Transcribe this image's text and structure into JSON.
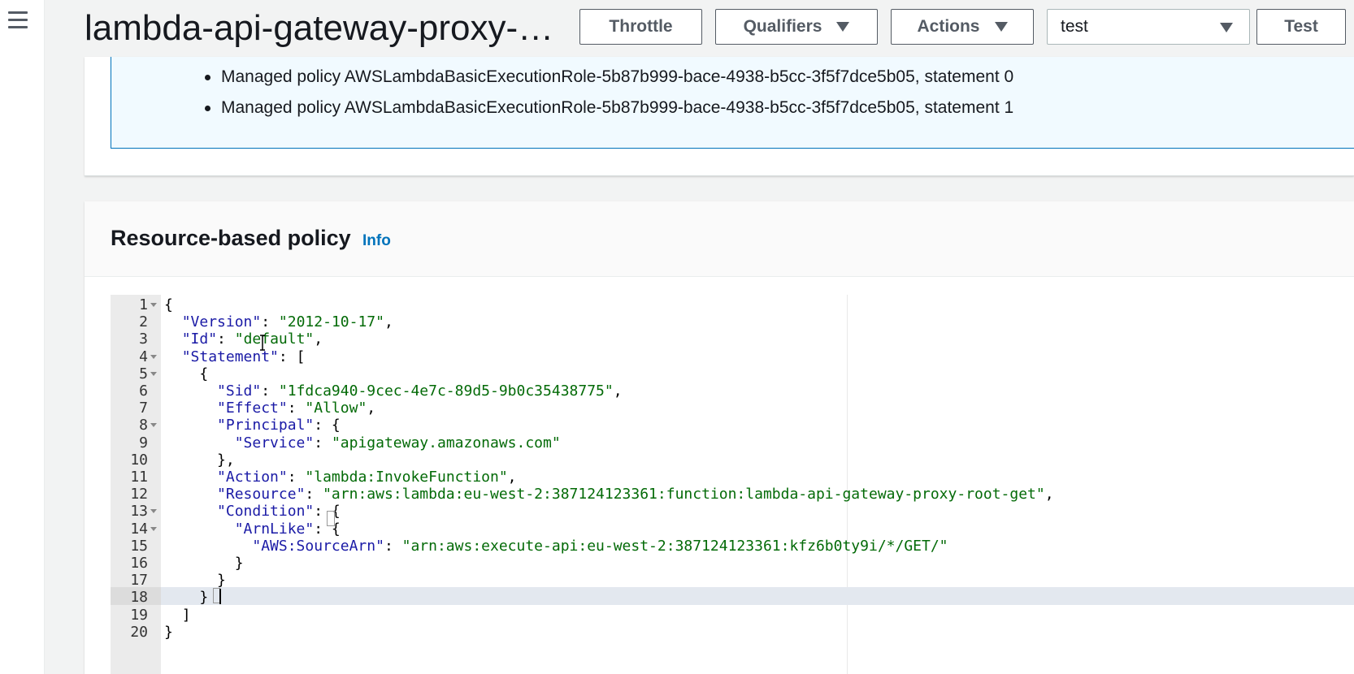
{
  "header": {
    "title": "lambda-api-gateway-proxy-…",
    "buttons": {
      "throttle": "Throttle",
      "qualifiers": "Qualifiers",
      "actions": "Actions",
      "test": "Test"
    },
    "test_event_select": "test"
  },
  "permissions_box": {
    "items": [
      "Managed policy AWSLambdaBasicExecutionRole-5b87b999-bace-4938-b5cc-3f5f7dce5b05, statement 0",
      "Managed policy AWSLambdaBasicExecutionRole-5b87b999-bace-4938-b5cc-3f5f7dce5b05, statement 1"
    ]
  },
  "resource_policy": {
    "title": "Resource-based policy",
    "info_link": "Info",
    "lines": [
      {
        "n": "1",
        "fold": true,
        "indent": "",
        "html": [
          [
            "p",
            "{"
          ]
        ]
      },
      {
        "n": "2",
        "fold": false,
        "indent": "  ",
        "html": [
          [
            "k",
            "\"Version\""
          ],
          [
            "p",
            ": "
          ],
          [
            "s",
            "\"2012-10-17\""
          ],
          [
            "p",
            ","
          ]
        ]
      },
      {
        "n": "3",
        "fold": false,
        "indent": "  ",
        "html": [
          [
            "k",
            "\"Id\""
          ],
          [
            "p",
            ": "
          ],
          [
            "s",
            "\"default\""
          ],
          [
            "p",
            ","
          ]
        ]
      },
      {
        "n": "4",
        "fold": true,
        "indent": "  ",
        "html": [
          [
            "k",
            "\"Statement\""
          ],
          [
            "p",
            ": ["
          ]
        ]
      },
      {
        "n": "5",
        "fold": true,
        "indent": "    ",
        "html": [
          [
            "p",
            "{"
          ]
        ]
      },
      {
        "n": "6",
        "fold": false,
        "indent": "      ",
        "html": [
          [
            "k",
            "\"Sid\""
          ],
          [
            "p",
            ": "
          ],
          [
            "s",
            "\"1fdca940-9cec-4e7c-89d5-9b0c35438775\""
          ],
          [
            "p",
            ","
          ]
        ]
      },
      {
        "n": "7",
        "fold": false,
        "indent": "      ",
        "html": [
          [
            "k",
            "\"Effect\""
          ],
          [
            "p",
            ": "
          ],
          [
            "s",
            "\"Allow\""
          ],
          [
            "p",
            ","
          ]
        ]
      },
      {
        "n": "8",
        "fold": true,
        "indent": "      ",
        "html": [
          [
            "k",
            "\"Principal\""
          ],
          [
            "p",
            ": {"
          ]
        ]
      },
      {
        "n": "9",
        "fold": false,
        "indent": "        ",
        "html": [
          [
            "k",
            "\"Service\""
          ],
          [
            "p",
            ": "
          ],
          [
            "s",
            "\"apigateway.amazonaws.com\""
          ]
        ]
      },
      {
        "n": "10",
        "fold": false,
        "indent": "      ",
        "html": [
          [
            "p",
            "},"
          ]
        ]
      },
      {
        "n": "11",
        "fold": false,
        "indent": "      ",
        "html": [
          [
            "k",
            "\"Action\""
          ],
          [
            "p",
            ": "
          ],
          [
            "s",
            "\"lambda:InvokeFunction\""
          ],
          [
            "p",
            ","
          ]
        ]
      },
      {
        "n": "12",
        "fold": false,
        "indent": "      ",
        "html": [
          [
            "k",
            "\"Resource\""
          ],
          [
            "p",
            ": "
          ],
          [
            "s",
            "\"arn:aws:lambda:eu-west-2:387124123361:function:lambda-api-gateway-proxy-root-get\""
          ],
          [
            "p",
            ","
          ]
        ]
      },
      {
        "n": "13",
        "fold": true,
        "indent": "      ",
        "html": [
          [
            "k",
            "\"Condition\""
          ],
          [
            "p",
            ": {"
          ]
        ]
      },
      {
        "n": "14",
        "fold": true,
        "indent": "        ",
        "html": [
          [
            "k",
            "\"ArnLike\""
          ],
          [
            "p",
            ": {"
          ]
        ]
      },
      {
        "n": "15",
        "fold": false,
        "indent": "          ",
        "html": [
          [
            "k",
            "\"AWS:SourceArn\""
          ],
          [
            "p",
            ": "
          ],
          [
            "s",
            "\"arn:aws:execute-api:eu-west-2:387124123361:kfz6b0ty9i/*/GET/\""
          ]
        ]
      },
      {
        "n": "16",
        "fold": false,
        "indent": "        ",
        "html": [
          [
            "p",
            "}"
          ]
        ]
      },
      {
        "n": "17",
        "fold": false,
        "indent": "      ",
        "html": [
          [
            "p",
            "}"
          ]
        ]
      },
      {
        "n": "18",
        "fold": false,
        "indent": "    ",
        "html": [
          [
            "p",
            "}"
          ]
        ]
      },
      {
        "n": "19",
        "fold": false,
        "indent": "  ",
        "html": [
          [
            "p",
            "]"
          ]
        ]
      },
      {
        "n": "20",
        "fold": false,
        "indent": "",
        "html": [
          [
            "p",
            "}"
          ]
        ]
      }
    ]
  },
  "colors": {
    "key": "#1a1aa6",
    "string": "#036a07",
    "info_border": "#0073bb",
    "info_bg": "#f1faff"
  }
}
